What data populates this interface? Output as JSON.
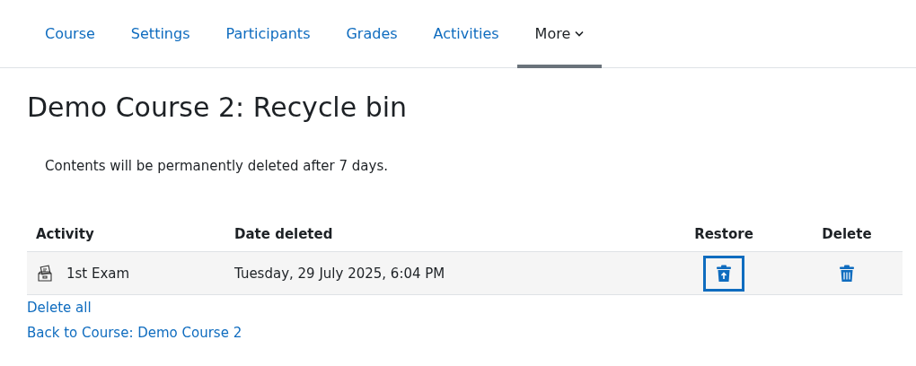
{
  "tabs": [
    {
      "label": "Course",
      "selected": false,
      "dropdown": false
    },
    {
      "label": "Settings",
      "selected": false,
      "dropdown": false
    },
    {
      "label": "Participants",
      "selected": false,
      "dropdown": false
    },
    {
      "label": "Grades",
      "selected": false,
      "dropdown": false
    },
    {
      "label": "Activities",
      "selected": false,
      "dropdown": false
    },
    {
      "label": "More",
      "selected": true,
      "dropdown": true
    }
  ],
  "title": "Demo Course 2: Recycle bin",
  "notice": "Contents will be permanently deleted after 7 days.",
  "table": {
    "columns": [
      "Activity",
      "Date deleted",
      "Restore",
      "Delete"
    ],
    "rows": [
      {
        "activity": "1st Exam",
        "date": "Tuesday, 29 July 2025, 6:04 PM",
        "restore_focused": true
      }
    ]
  },
  "links": [
    "Delete all",
    "Back to Course: Demo Course 2"
  ]
}
